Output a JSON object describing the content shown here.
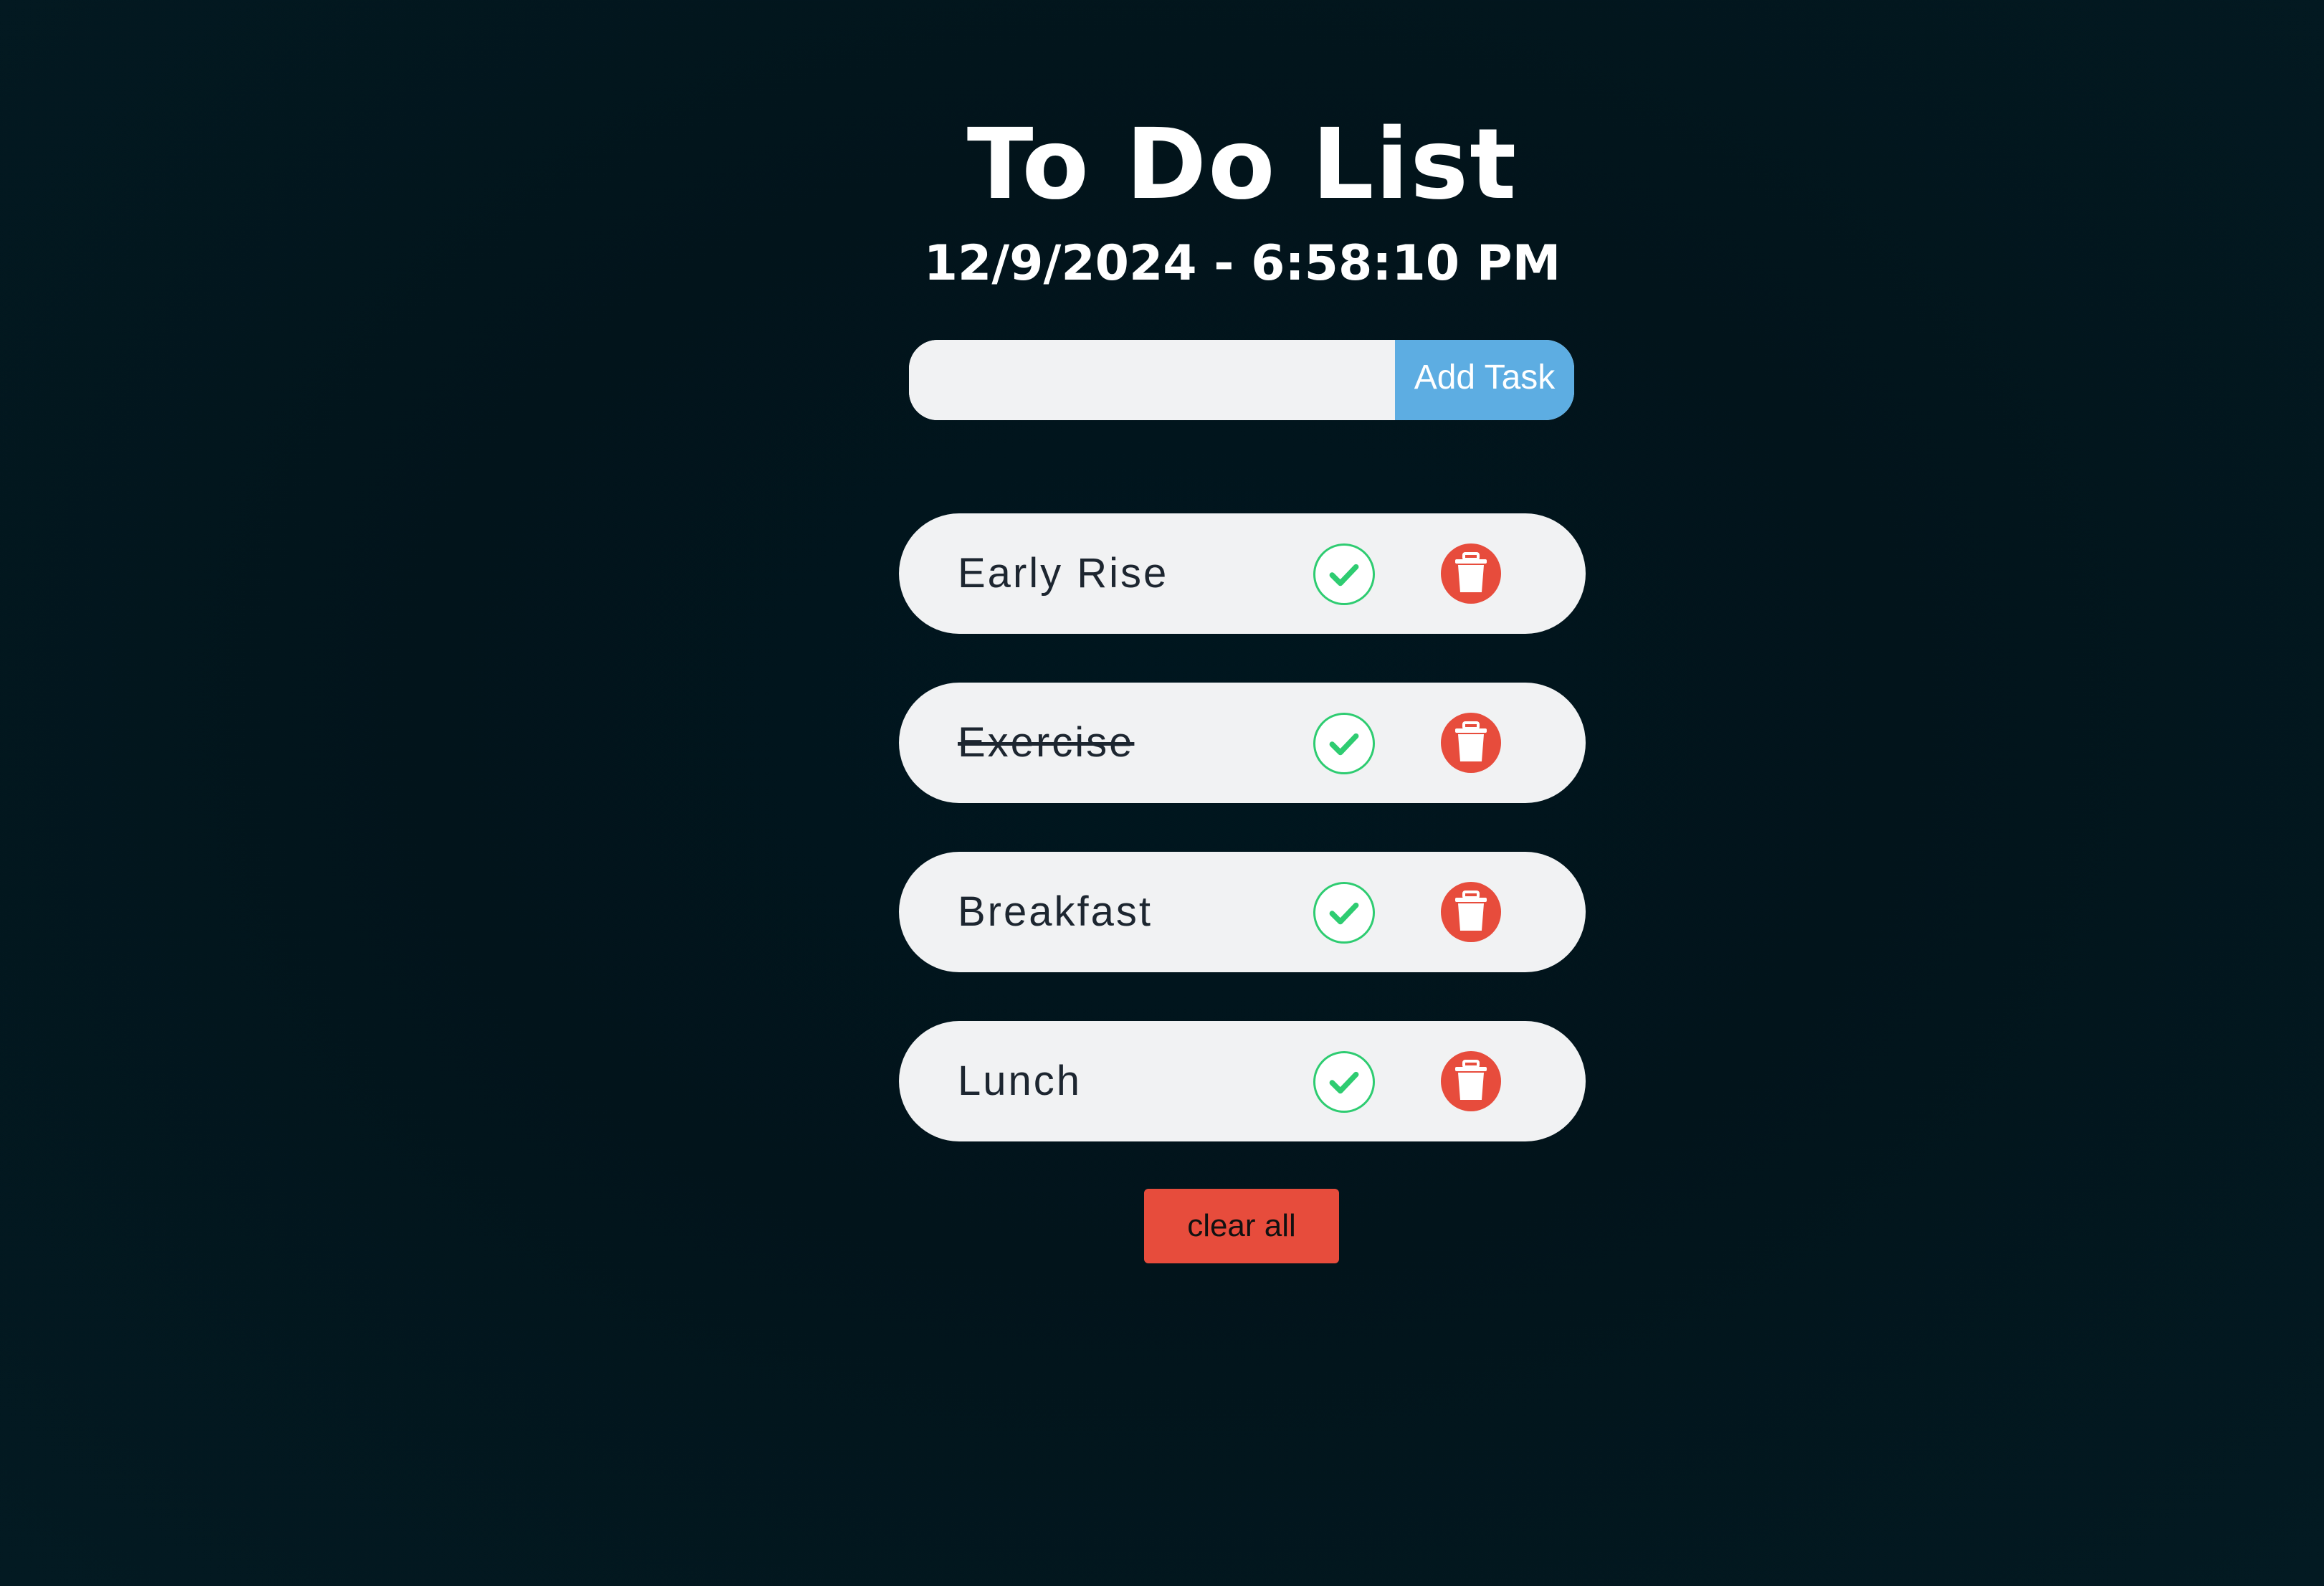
{
  "header": {
    "title": "To Do List",
    "datetime": "12/9/2024 - 6:58:10 PM"
  },
  "add_form": {
    "input_value": "",
    "input_placeholder": "",
    "button_label": "Add Task"
  },
  "tasks": [
    {
      "label": "Early Rise",
      "completed": false
    },
    {
      "label": "Exercise",
      "completed": true
    },
    {
      "label": "Breakfast",
      "completed": false
    },
    {
      "label": "Lunch",
      "completed": false
    }
  ],
  "icons": {
    "complete": "check-icon",
    "delete": "trash-icon"
  },
  "footer": {
    "clear_label": "clear all"
  },
  "colors": {
    "background": "#011820",
    "accent_blue": "#5dade2",
    "accent_red": "#e74c3c",
    "accent_green": "#2ecc71",
    "card": "#f1f2f3"
  }
}
